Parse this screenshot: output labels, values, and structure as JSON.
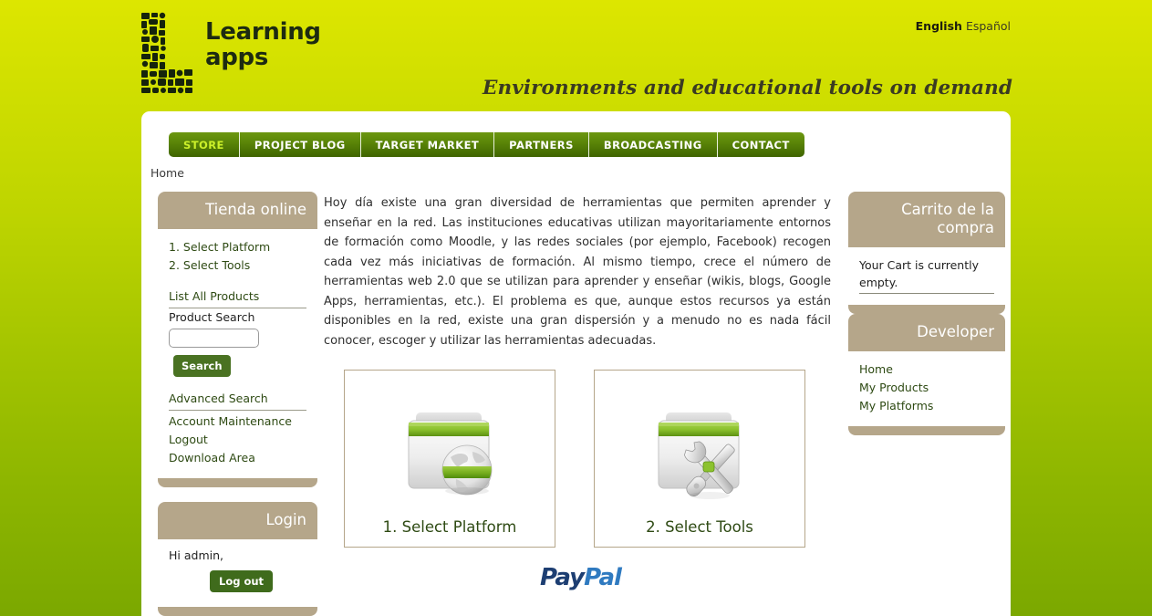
{
  "header": {
    "logo_line1": "Learning",
    "logo_line2": "apps",
    "logo_icon": "learning-apps-logo",
    "lang_active": "English",
    "lang_inactive": "Español",
    "tagline": "Environments and educational tools on demand"
  },
  "nav": {
    "items": [
      {
        "label": "STORE",
        "active": true
      },
      {
        "label": "PROJECT BLOG",
        "active": false
      },
      {
        "label": "TARGET MARKET",
        "active": false
      },
      {
        "label": "PARTNERS",
        "active": false
      },
      {
        "label": "BROADCASTING",
        "active": false
      },
      {
        "label": "CONTACT",
        "active": false
      }
    ]
  },
  "breadcrumb": {
    "text": "Home"
  },
  "sidebar_left": {
    "store": {
      "title": "Tienda online",
      "links": [
        "1. Select Platform",
        "2. Select Tools"
      ],
      "list_all": "List All Products",
      "search_label": "Product Search",
      "search_value": "",
      "search_placeholder": "",
      "search_button": "Search",
      "advanced_search": "Advanced Search",
      "account_links": [
        "Account Maintenance",
        "Logout",
        "Download Area"
      ]
    },
    "login": {
      "title": "Login",
      "greeting": "Hi admin,",
      "logout_button": "Log out"
    }
  },
  "sidebar_right": {
    "cart": {
      "title": "Carrito de la compra",
      "message": "Your Cart is currently empty."
    },
    "developer": {
      "title": "Developer",
      "links": [
        "Home",
        "My Products",
        "My Platforms"
      ]
    }
  },
  "main": {
    "intro": "Hoy día existe una gran diversidad de herramientas que permiten aprender y enseñar en la red. Las instituciones educativas utilizan mayoritariamente entornos de formación como Moodle, y las redes sociales (por ejemplo, Facebook) recogen cada vez más iniciativas de formación. Al mismo tiempo, crece el número de herramientas web 2.0 que se utilizan para aprender y enseñar (wikis, blogs, Google Apps, herramientas, etc.). El problema es que, aunque estos recursos ya están disponibles en la red, existe una gran dispersión y a menudo no es nada fácil conocer, escoger y utilizar las herramientas adecuadas.",
    "cards": [
      {
        "label": "1. Select Platform",
        "icon": "folder-globe-icon"
      },
      {
        "label": "2. Select Tools",
        "icon": "folder-tools-icon"
      }
    ],
    "paypal": {
      "part1": "Pay",
      "part2": "Pal"
    }
  },
  "colors": {
    "background_top": "#dde600",
    "background_bottom": "#7ba800",
    "panel_header": "#b5a68a",
    "nav_green": "#5b8608",
    "nav_active_text": "#ccf02a",
    "link_green": "#2e4a13",
    "button_green": "#4a7222",
    "paypal_dark": "#1d3e72",
    "paypal_light": "#2f7ac0"
  }
}
